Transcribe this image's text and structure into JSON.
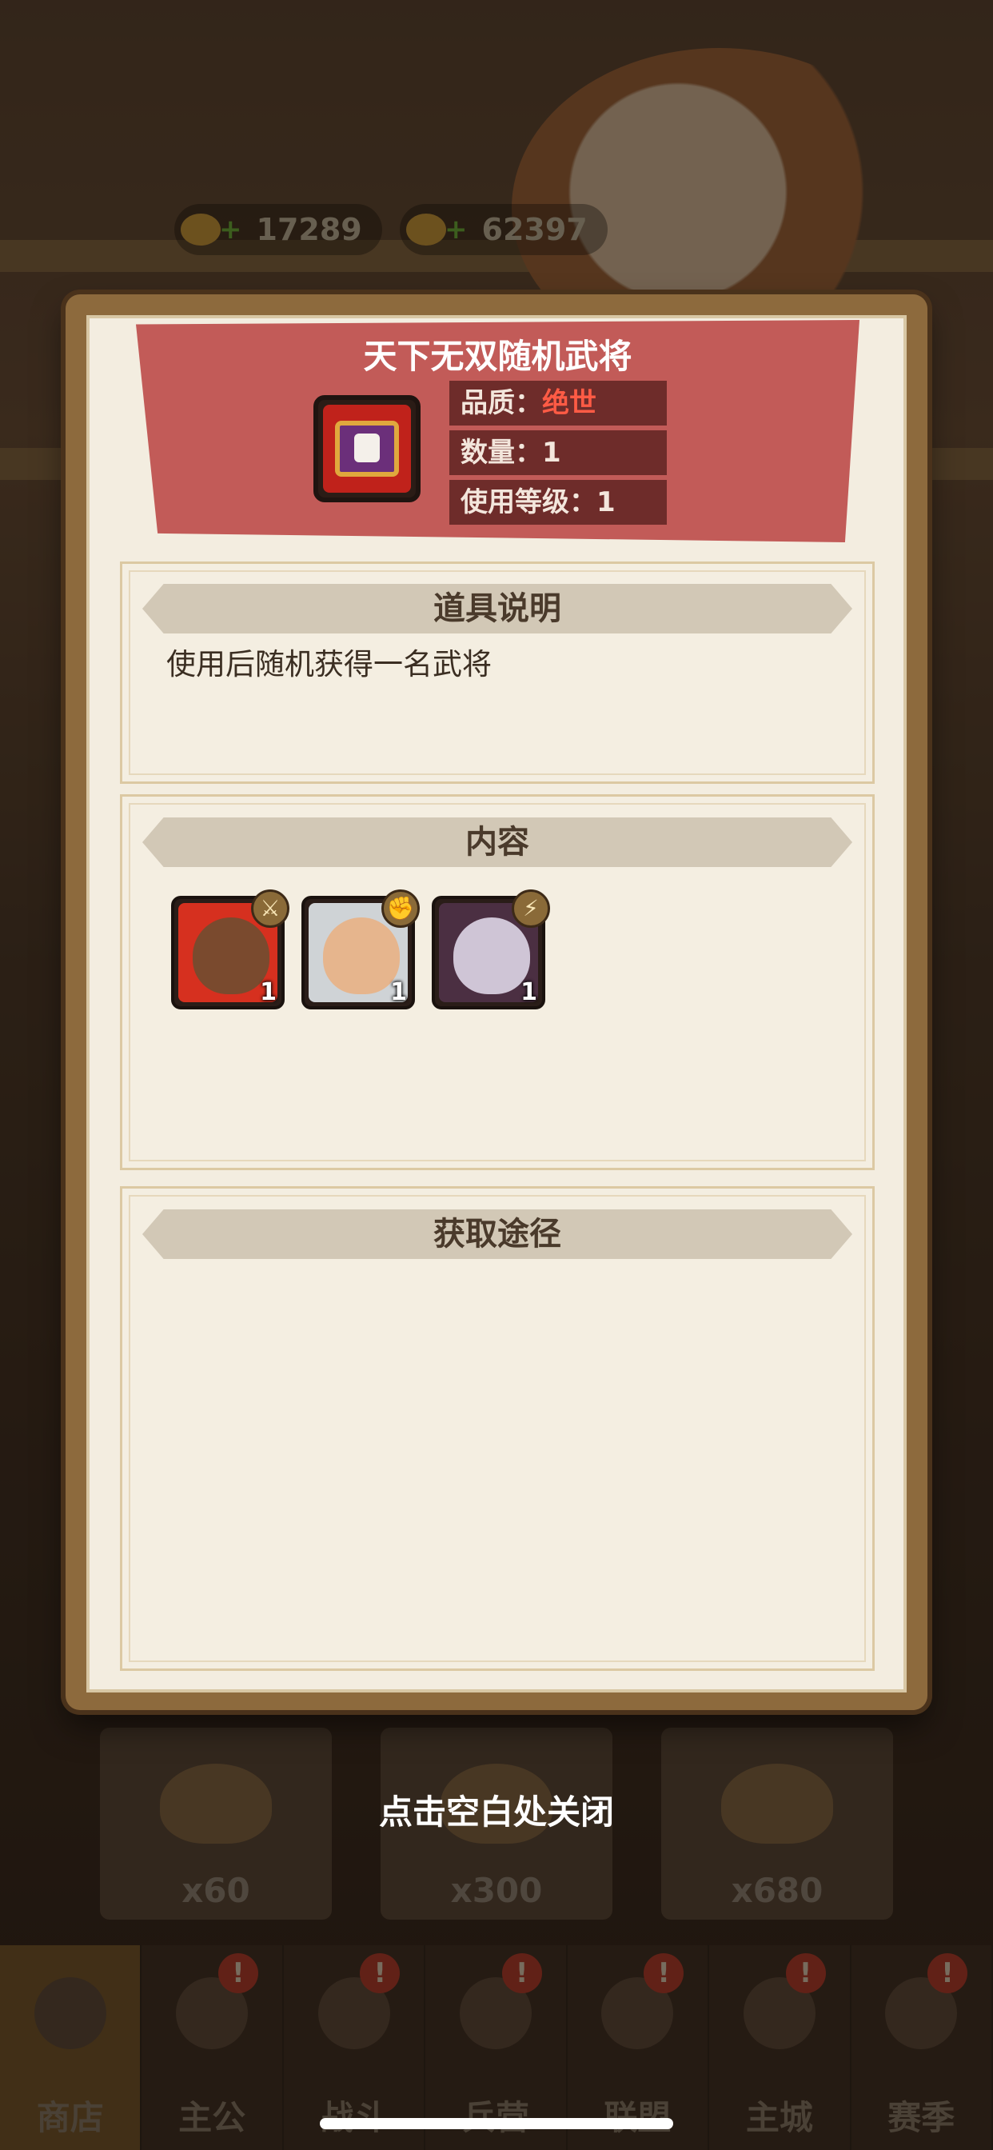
{
  "background": {
    "currencies": [
      {
        "icon": "gold-ingot-icon",
        "value": "17289"
      },
      {
        "icon": "coin-icon",
        "value": "62397"
      }
    ],
    "shop_cards": [
      {
        "count": "x60"
      },
      {
        "count": "x300"
      },
      {
        "count": "x680"
      }
    ],
    "tabs": [
      {
        "label": "商店",
        "icon": "shop-scale-icon",
        "badge": "",
        "active": true
      },
      {
        "label": "主公",
        "icon": "lord-helmet-icon",
        "badge": "!"
      },
      {
        "label": "战斗",
        "icon": "crossed-swords-icon",
        "badge": "!"
      },
      {
        "label": "兵营",
        "icon": "barracks-flag-icon",
        "badge": "!"
      },
      {
        "label": "联盟",
        "icon": "alliance-banner-icon",
        "badge": "!"
      },
      {
        "label": "主城",
        "icon": "city-scroll-icon",
        "badge": "!"
      },
      {
        "label": "赛季",
        "icon": "season-dragon-icon",
        "badge": "!"
      }
    ]
  },
  "item": {
    "title": "天下无双随机武将",
    "icon": "purple-chest-icon",
    "quality_label": "品质：",
    "quality_value": "绝世",
    "quality_color": "#ff5b45",
    "quantity": "数量：1",
    "use_level": "使用等级：1"
  },
  "description": {
    "heading": "道具说明",
    "text": "使用后随机获得一名武将"
  },
  "contents": {
    "heading": "内容",
    "heroes": [
      {
        "portrait": "warrior-hero-portrait",
        "type_icon": "sword-icon",
        "count": "1"
      },
      {
        "portrait": "white-helmet-hero-portrait",
        "type_icon": "fist-icon",
        "count": "1"
      },
      {
        "portrait": "masked-hero-portrait",
        "type_icon": "lightning-icon",
        "count": "1"
      }
    ]
  },
  "acquire": {
    "heading": "获取途径"
  },
  "close_hint": "点击空白处关闭"
}
